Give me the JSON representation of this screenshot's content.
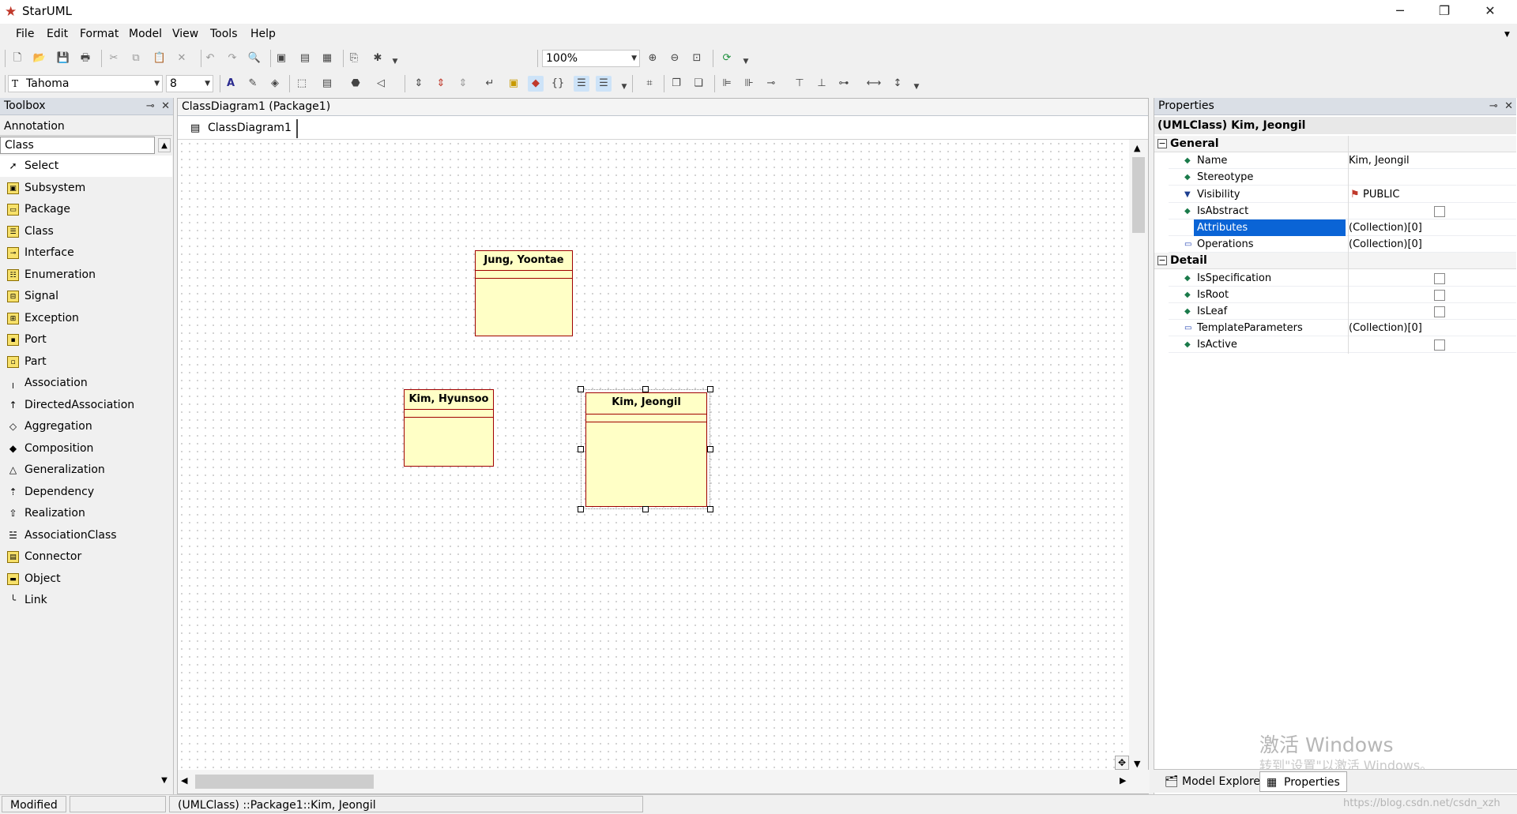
{
  "window": {
    "title": "StarUML",
    "minimize_glyph": "─",
    "restore_glyph": "❐",
    "close_glyph": "✕"
  },
  "menu": [
    {
      "label": "File",
      "key": "F"
    },
    {
      "label": "Edit",
      "key": "E"
    },
    {
      "label": "Format",
      "key": "o"
    },
    {
      "label": "Model",
      "key": "M"
    },
    {
      "label": "View",
      "key": "V"
    },
    {
      "label": "Tools",
      "key": "T"
    },
    {
      "label": "Help",
      "key": "H"
    }
  ],
  "toolbar": {
    "zoom_value": "100%",
    "font_name": "Tahoma",
    "font_size": "8"
  },
  "toolbox": {
    "title": "Toolbox",
    "section_annotation": "Annotation",
    "section_class": "Class",
    "items": [
      {
        "label": "Select",
        "icon": "cursor-icon"
      },
      {
        "label": "Subsystem",
        "icon": "subsystem-icon"
      },
      {
        "label": "Package",
        "icon": "package-icon"
      },
      {
        "label": "Class",
        "icon": "class-icon"
      },
      {
        "label": "Interface",
        "icon": "interface-icon"
      },
      {
        "label": "Enumeration",
        "icon": "enumeration-icon"
      },
      {
        "label": "Signal",
        "icon": "signal-icon"
      },
      {
        "label": "Exception",
        "icon": "exception-icon"
      },
      {
        "label": "Port",
        "icon": "port-icon"
      },
      {
        "label": "Part",
        "icon": "part-icon"
      },
      {
        "label": "Association",
        "icon": "association-icon"
      },
      {
        "label": "DirectedAssociation",
        "icon": "directed-association-icon"
      },
      {
        "label": "Aggregation",
        "icon": "aggregation-icon"
      },
      {
        "label": "Composition",
        "icon": "composition-icon"
      },
      {
        "label": "Generalization",
        "icon": "generalization-icon"
      },
      {
        "label": "Dependency",
        "icon": "dependency-icon"
      },
      {
        "label": "Realization",
        "icon": "realization-icon"
      },
      {
        "label": "AssociationClass",
        "icon": "association-class-icon"
      },
      {
        "label": "Connector",
        "icon": "connector-icon"
      },
      {
        "label": "Object",
        "icon": "object-icon"
      },
      {
        "label": "Link",
        "icon": "link-icon"
      }
    ]
  },
  "diagram": {
    "header": "ClassDiagram1 (Package1)",
    "tab_label": "ClassDiagram1",
    "classes": [
      {
        "name": "Jung, Yoontae"
      },
      {
        "name": "Kim, Hyunsoo"
      },
      {
        "name": "Kim, Jeongil",
        "selected": true
      }
    ]
  },
  "properties": {
    "title": "Properties",
    "selected_header": "(UMLClass) Kim, Jeongil",
    "general_label": "General",
    "general_rows": [
      {
        "name": "Name",
        "value": "Kim, Jeongil"
      },
      {
        "name": "Stereotype",
        "value": ""
      },
      {
        "name": "Visibility",
        "value": "PUBLIC"
      },
      {
        "name": "IsAbstract",
        "value": ""
      },
      {
        "name": "Attributes",
        "value": "(Collection)[0]",
        "selected": true
      },
      {
        "name": "Operations",
        "value": "(Collection)[0]"
      }
    ],
    "detail_label": "Detail",
    "detail_rows": [
      {
        "name": "IsSpecification",
        "value": ""
      },
      {
        "name": "IsRoot",
        "value": ""
      },
      {
        "name": "IsLeaf",
        "value": ""
      },
      {
        "name": "TemplateParameters",
        "value": "(Collection)[0]"
      },
      {
        "name": "IsActive",
        "value": ""
      }
    ]
  },
  "bottom_tabs": {
    "model_explorer": "Model Explorer",
    "properties": "Properties"
  },
  "status": {
    "state": "Modified",
    "path": "(UMLClass) ::Package1::Kim, Jeongil"
  },
  "watermark": {
    "line1": "激活 Windows",
    "line2": "转到\"设置\"以激活 Windows。",
    "credit": "https://blog.csdn.net/csdn_xzh"
  },
  "colors": {
    "class_fill": "#ffffc6",
    "class_border": "#a00000",
    "selection": "#0a64d6"
  }
}
